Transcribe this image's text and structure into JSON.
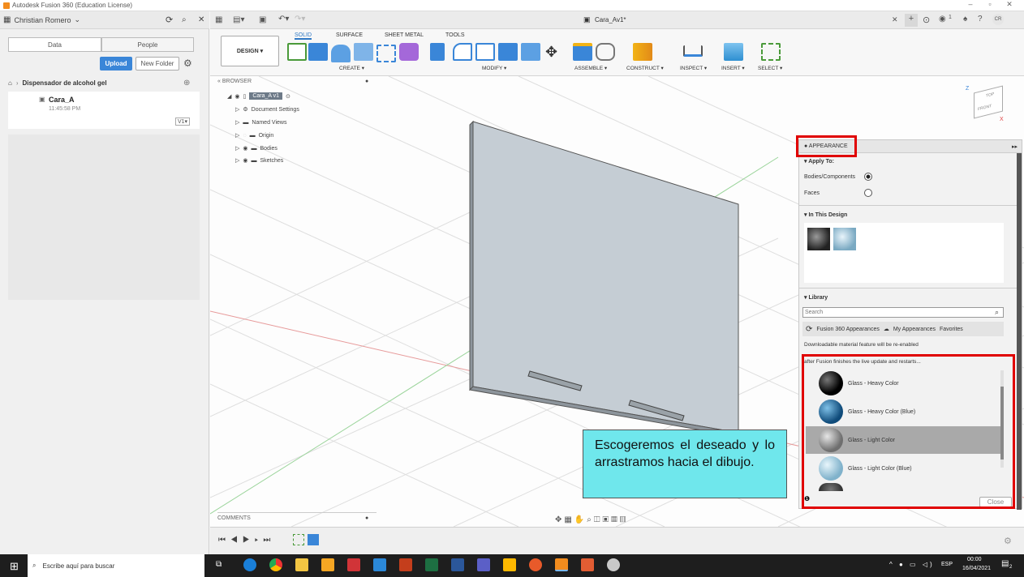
{
  "titlebar": {
    "title": "Autodesk Fusion 360 (Education License)",
    "min": "–",
    "restore": "▫",
    "close": "✕"
  },
  "leftpanel": {
    "user": "Christian Romero",
    "tabs": [
      "Data",
      "People"
    ],
    "upload": "Upload",
    "new_folder": "New Folder",
    "breadcrumb": "Dispensador de alcohol gel",
    "file": {
      "name": "Cara_A",
      "time": "11:45:58 PM",
      "version": "V1▾"
    }
  },
  "toolbar": {
    "workspace": "DESIGN ▾",
    "tabs": [
      "SOLID",
      "SURFACE",
      "SHEET METAL",
      "TOOLS"
    ],
    "groups": [
      "CREATE ▾",
      "MODIFY ▾",
      "ASSEMBLE ▾",
      "CONSTRUCT ▾",
      "INSPECT ▾",
      "INSERT ▾",
      "SELECT ▾"
    ]
  },
  "doc": {
    "title": "Cara_Av1*",
    "user_initials": "CR",
    "notif": "1"
  },
  "browser": {
    "label": "BROWSER",
    "root": "Cara_A v1",
    "items": [
      "Document Settings",
      "Named Views",
      "Origin",
      "Bodies",
      "Sketches"
    ]
  },
  "comments": {
    "label": "COMMENTS"
  },
  "viewcube": {
    "top": "TOP",
    "front": "FRONT",
    "z": "Z",
    "x": "X"
  },
  "appearance": {
    "title": "APPEARANCE",
    "apply_to": "Apply To:",
    "bodies": "Bodies/Components",
    "faces": "Faces",
    "in_design": "In This Design",
    "library": "Library",
    "search_placeholder": "Search",
    "lib_tabs": [
      "Fusion 360 Appearances",
      "My Appearances",
      "Favorites"
    ],
    "notice1": "Downloadable material feature will be re-enabled",
    "notice2": "after Fusion finishes the live update and restarts...",
    "items": [
      "Glass - Heavy Color",
      "Glass - Heavy Color (Blue)",
      "Glass - Light Color",
      "Glass - Light Color (Blue)"
    ],
    "close": "Close"
  },
  "callout": {
    "text": "Escogeremos el deseado y lo arrastramos hacia el dibujo."
  },
  "taskbar": {
    "search": "Escribe aquí para buscar",
    "lang": "ESP",
    "time": "00:00",
    "date": "16/04/2021",
    "notif": "2"
  },
  "colors": {
    "accent": "#3a86d8",
    "highlight": "#e00000",
    "callout": "#6fe7ec"
  }
}
